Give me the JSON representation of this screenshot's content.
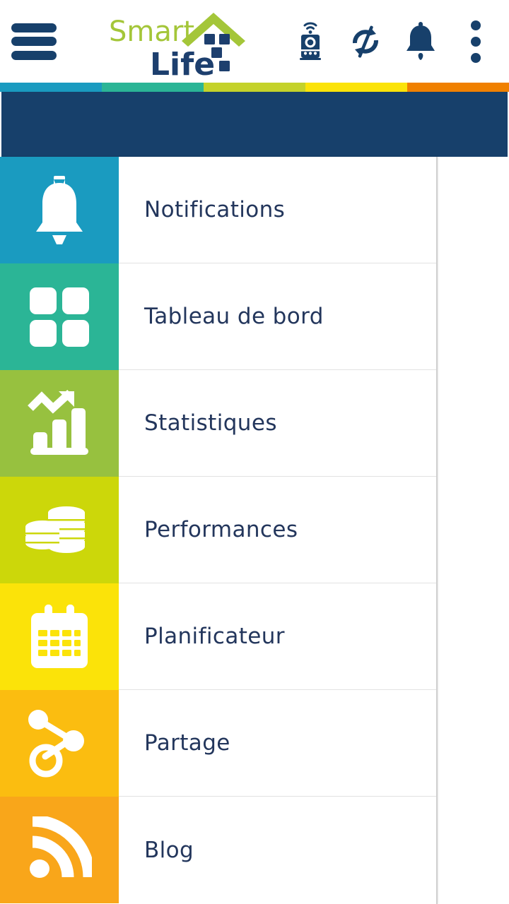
{
  "app": {
    "title": "Smart Life",
    "logo": {
      "word_one": "Smart",
      "word_two": "Life",
      "word_one_color": "#a4c639",
      "word_two_color": "#1d3f6e"
    }
  },
  "appbar": {
    "menu_button": "menu-icon",
    "actions": [
      {
        "name": "smart-device-icon",
        "label": "Appareil"
      },
      {
        "name": "sync-icon",
        "label": "Synchroniser"
      },
      {
        "name": "bell-icon",
        "label": "Notifications"
      },
      {
        "name": "overflow-menu-icon",
        "label": "Plus"
      }
    ]
  },
  "stripe": {
    "colors": [
      "#1a9bc0",
      "#2bb596",
      "#c4d22a",
      "#fbe309",
      "#f08000"
    ]
  },
  "header_band": {
    "color": "#17406b"
  },
  "drawer": {
    "items": [
      {
        "label": "Notifications",
        "icon": "bell-icon",
        "color": "#1a9bc0"
      },
      {
        "label": "Tableau de bord",
        "icon": "grid-icon",
        "color": "#2bb596"
      },
      {
        "label": "Statistiques",
        "icon": "bar-chart-icon",
        "color": "#97c13f"
      },
      {
        "label": "Performances",
        "icon": "coins-icon",
        "color": "#ccd70a"
      },
      {
        "label": "Planificateur",
        "icon": "calendar-icon",
        "color": "#fbe309"
      },
      {
        "label": "Partage",
        "icon": "share-icon",
        "color": "#fbbd10"
      },
      {
        "label": "Blog",
        "icon": "rss-icon",
        "color": "#f9a61a"
      }
    ]
  },
  "colors": {
    "navy": "#17406b",
    "text": "#23365c",
    "divider": "#e2e2e2",
    "background": "#ffffff"
  }
}
